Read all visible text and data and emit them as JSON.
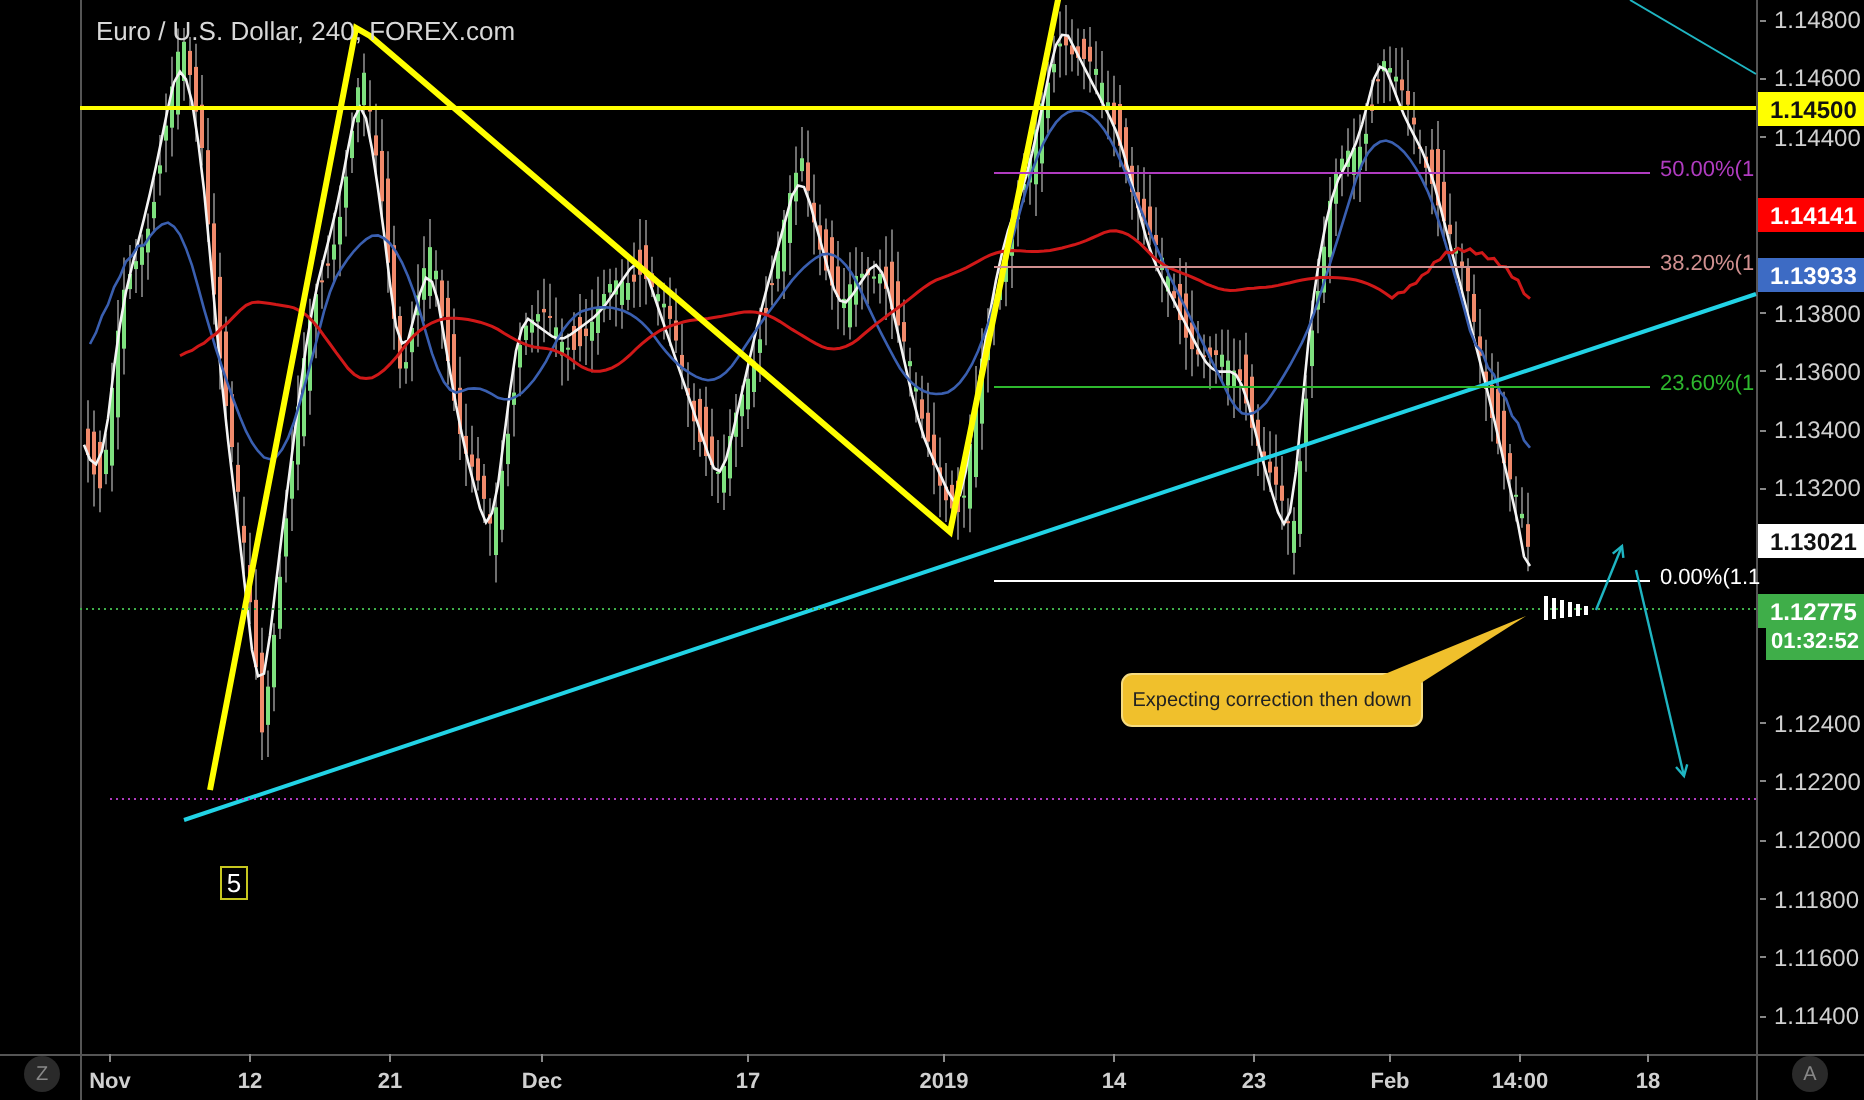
{
  "chart_title": "Euro / U.S. Dollar, 240, FOREX.com",
  "price_axis": {
    "ticks": [
      "1.14800",
      "1.14600",
      "1.14400",
      "1.13800",
      "1.13600",
      "1.13400",
      "1.13200",
      "1.12400",
      "1.12200",
      "1.12000",
      "1.11800",
      "1.11600",
      "1.11400"
    ],
    "tags": [
      {
        "text": "1.14500",
        "color": "#ffff00"
      },
      {
        "text": "1.14141",
        "color": "#ff0000"
      },
      {
        "text": "1.13933",
        "color": "#3d6bc4"
      },
      {
        "text": "1.13021",
        "color": "#ffffff"
      },
      {
        "text": "1.12775",
        "color": "#3fae49"
      }
    ],
    "countdown": {
      "text": "01:32:52",
      "color": "#3fae49"
    }
  },
  "time_axis": {
    "labels": [
      "Nov",
      "12",
      "21",
      "Dec",
      "17",
      "2019",
      "14",
      "23",
      "Feb",
      "14:00",
      "18"
    ]
  },
  "fibonacci_levels": [
    {
      "label": "50.00%(1",
      "color": "#b03cc0"
    },
    {
      "label": "38.20%(1",
      "color": "#d09090"
    },
    {
      "label": "23.60%(1",
      "color": "#2eb82e"
    },
    {
      "label": "0.00%(1.1",
      "color": "#ffffff"
    }
  ],
  "annotation": {
    "text": "Expecting correction then down"
  },
  "wave_label": "5",
  "corner_buttons": [
    "Z",
    "A"
  ]
}
